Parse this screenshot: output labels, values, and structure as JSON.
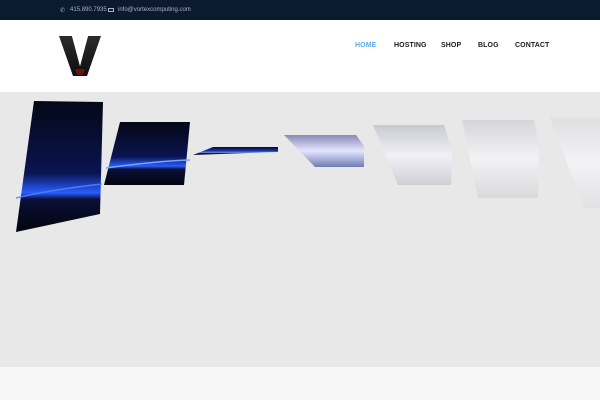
{
  "topbar": {
    "phone": "415.890.7935",
    "email": "info@vortexcomputing.com",
    "phone_icon": "phone-icon",
    "email_icon": "envelope-icon"
  },
  "header": {
    "logo_letter": "V",
    "nav": [
      {
        "label": "HOME",
        "active": true
      },
      {
        "label": "HOSTING",
        "active": false
      },
      {
        "label": "SHOP",
        "active": false
      },
      {
        "label": "BLOG",
        "active": false
      },
      {
        "label": "CONTACT",
        "active": false
      }
    ]
  },
  "colors": {
    "topbar_bg": "#0c1a30",
    "nav_active": "#5ea9e6",
    "nav_text": "#1a1a1a",
    "slider_bg": "#e8e8e8"
  }
}
